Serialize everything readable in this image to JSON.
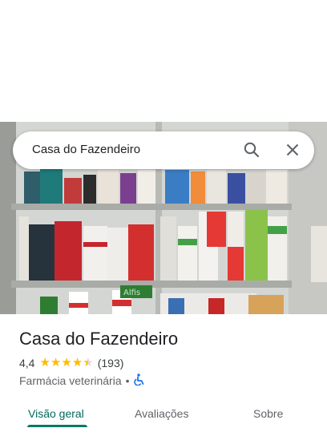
{
  "search": {
    "query": "Casa do Fazendeiro",
    "search_icon": "search-icon",
    "clear_icon": "close-icon"
  },
  "photo": {
    "sign_text": "Alfis"
  },
  "place": {
    "title": "Casa do Fazendeiro",
    "rating": "4,4",
    "stars": 4.4,
    "review_count": "(193)",
    "category": "Farmácia veterinária",
    "separator": "•",
    "accessibility_icon": "wheelchair-icon"
  },
  "tabs": [
    {
      "label": "Visão geral",
      "active": true
    },
    {
      "label": "Avaliações",
      "active": false
    },
    {
      "label": "Sobre",
      "active": false
    }
  ],
  "colors": {
    "accent": "#00796b",
    "star": "#fbbc04",
    "accessibility": "#1a73e8"
  }
}
